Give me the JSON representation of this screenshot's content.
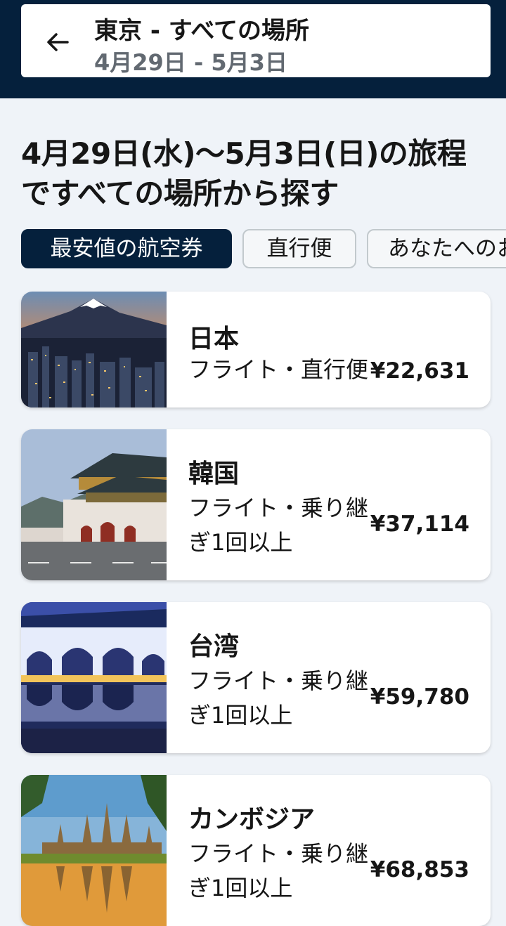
{
  "header": {
    "route": "東京 - すべての場所",
    "dates": "4月29日 - 5月3日",
    "back_icon": "arrow-left-icon"
  },
  "main": {
    "heading": "4月29日(水)〜5月3日(日)の旅程ですべての場所から探す"
  },
  "filters": [
    {
      "label": "最安値の航空券",
      "active": true
    },
    {
      "label": "直行便",
      "active": false
    },
    {
      "label": "あなたへのおすすめ",
      "active": false
    }
  ],
  "destinations": [
    {
      "country": "日本",
      "detail": "フライト・直行便",
      "price": "¥22,631",
      "image": "mount-fuji-city-night"
    },
    {
      "country": "韓国",
      "detail": "フライト・乗り継ぎ1回以上",
      "price": "¥37,114",
      "image": "gyeongbokgung-palace-gate"
    },
    {
      "country": "台湾",
      "detail": "フライト・乗り継ぎ1回以上",
      "price": "¥59,780",
      "image": "liberty-square-gate-reflection"
    },
    {
      "country": "カンボジア",
      "detail": "フライト・乗り継ぎ1回以上",
      "price": "¥68,853",
      "image": "angkor-wat-sunrise"
    }
  ]
}
